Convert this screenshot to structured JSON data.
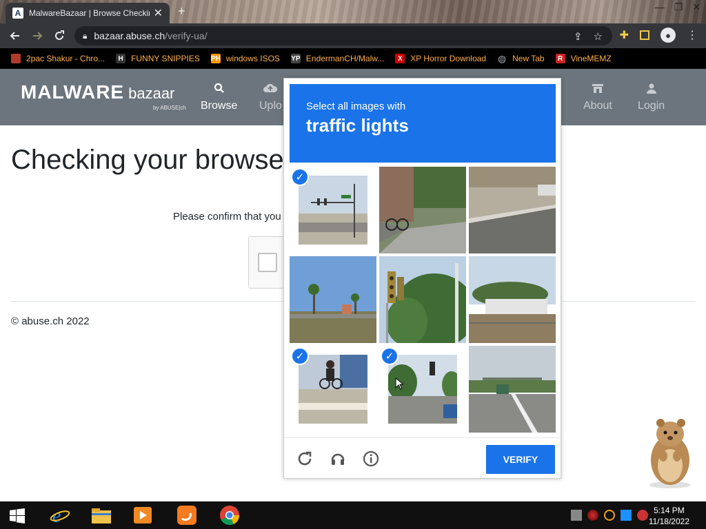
{
  "browser": {
    "tab_title": "MalwareBazaar | Browse Checking",
    "tab_favicon": "A",
    "url_host": "bazaar.abuse.ch",
    "url_path": "/verify-ua/"
  },
  "bookmarks": [
    {
      "label": "2pac Shakur - Chro...",
      "icon": "tupac-icon",
      "color": "#b03a2e"
    },
    {
      "label": "FUNNY SNIPPIES",
      "icon": "H",
      "color": "#333333"
    },
    {
      "label": "windows ISOS",
      "icon": "PH",
      "color": "#ff9900"
    },
    {
      "label": "EndermanCH/Malw...",
      "icon": "YP",
      "color": "#444444"
    },
    {
      "label": "XP Horror Download",
      "icon": "X",
      "color": "#cc0000"
    },
    {
      "label": "New Tab",
      "icon": "globe-icon",
      "color": "#666666"
    },
    {
      "label": "VineMEMZ",
      "icon": "R",
      "color": "#cc2222"
    }
  ],
  "site": {
    "logo_main": "MALWARE",
    "logo_sub": "bazaar",
    "logo_by": "by ABUSE|ch",
    "nav": [
      {
        "label": "Browse",
        "icon": "search-icon"
      },
      {
        "label": "Uplo",
        "icon": "upload-icon"
      },
      {
        "label": "About",
        "icon": "building-icon"
      },
      {
        "label": "Login",
        "icon": "user-icon"
      }
    ],
    "page_title": "Checking your browse",
    "confirm_text": "Please confirm that you",
    "footer": "© abuse.ch 2022"
  },
  "captcha": {
    "instruction": "Select all images with",
    "target": "traffic lights",
    "verify_label": "VERIFY",
    "tiles_selected": [
      true,
      false,
      false,
      false,
      false,
      false,
      true,
      true,
      false
    ]
  },
  "taskbar": {
    "time": "5:14 PM",
    "date": "11/18/2022"
  }
}
